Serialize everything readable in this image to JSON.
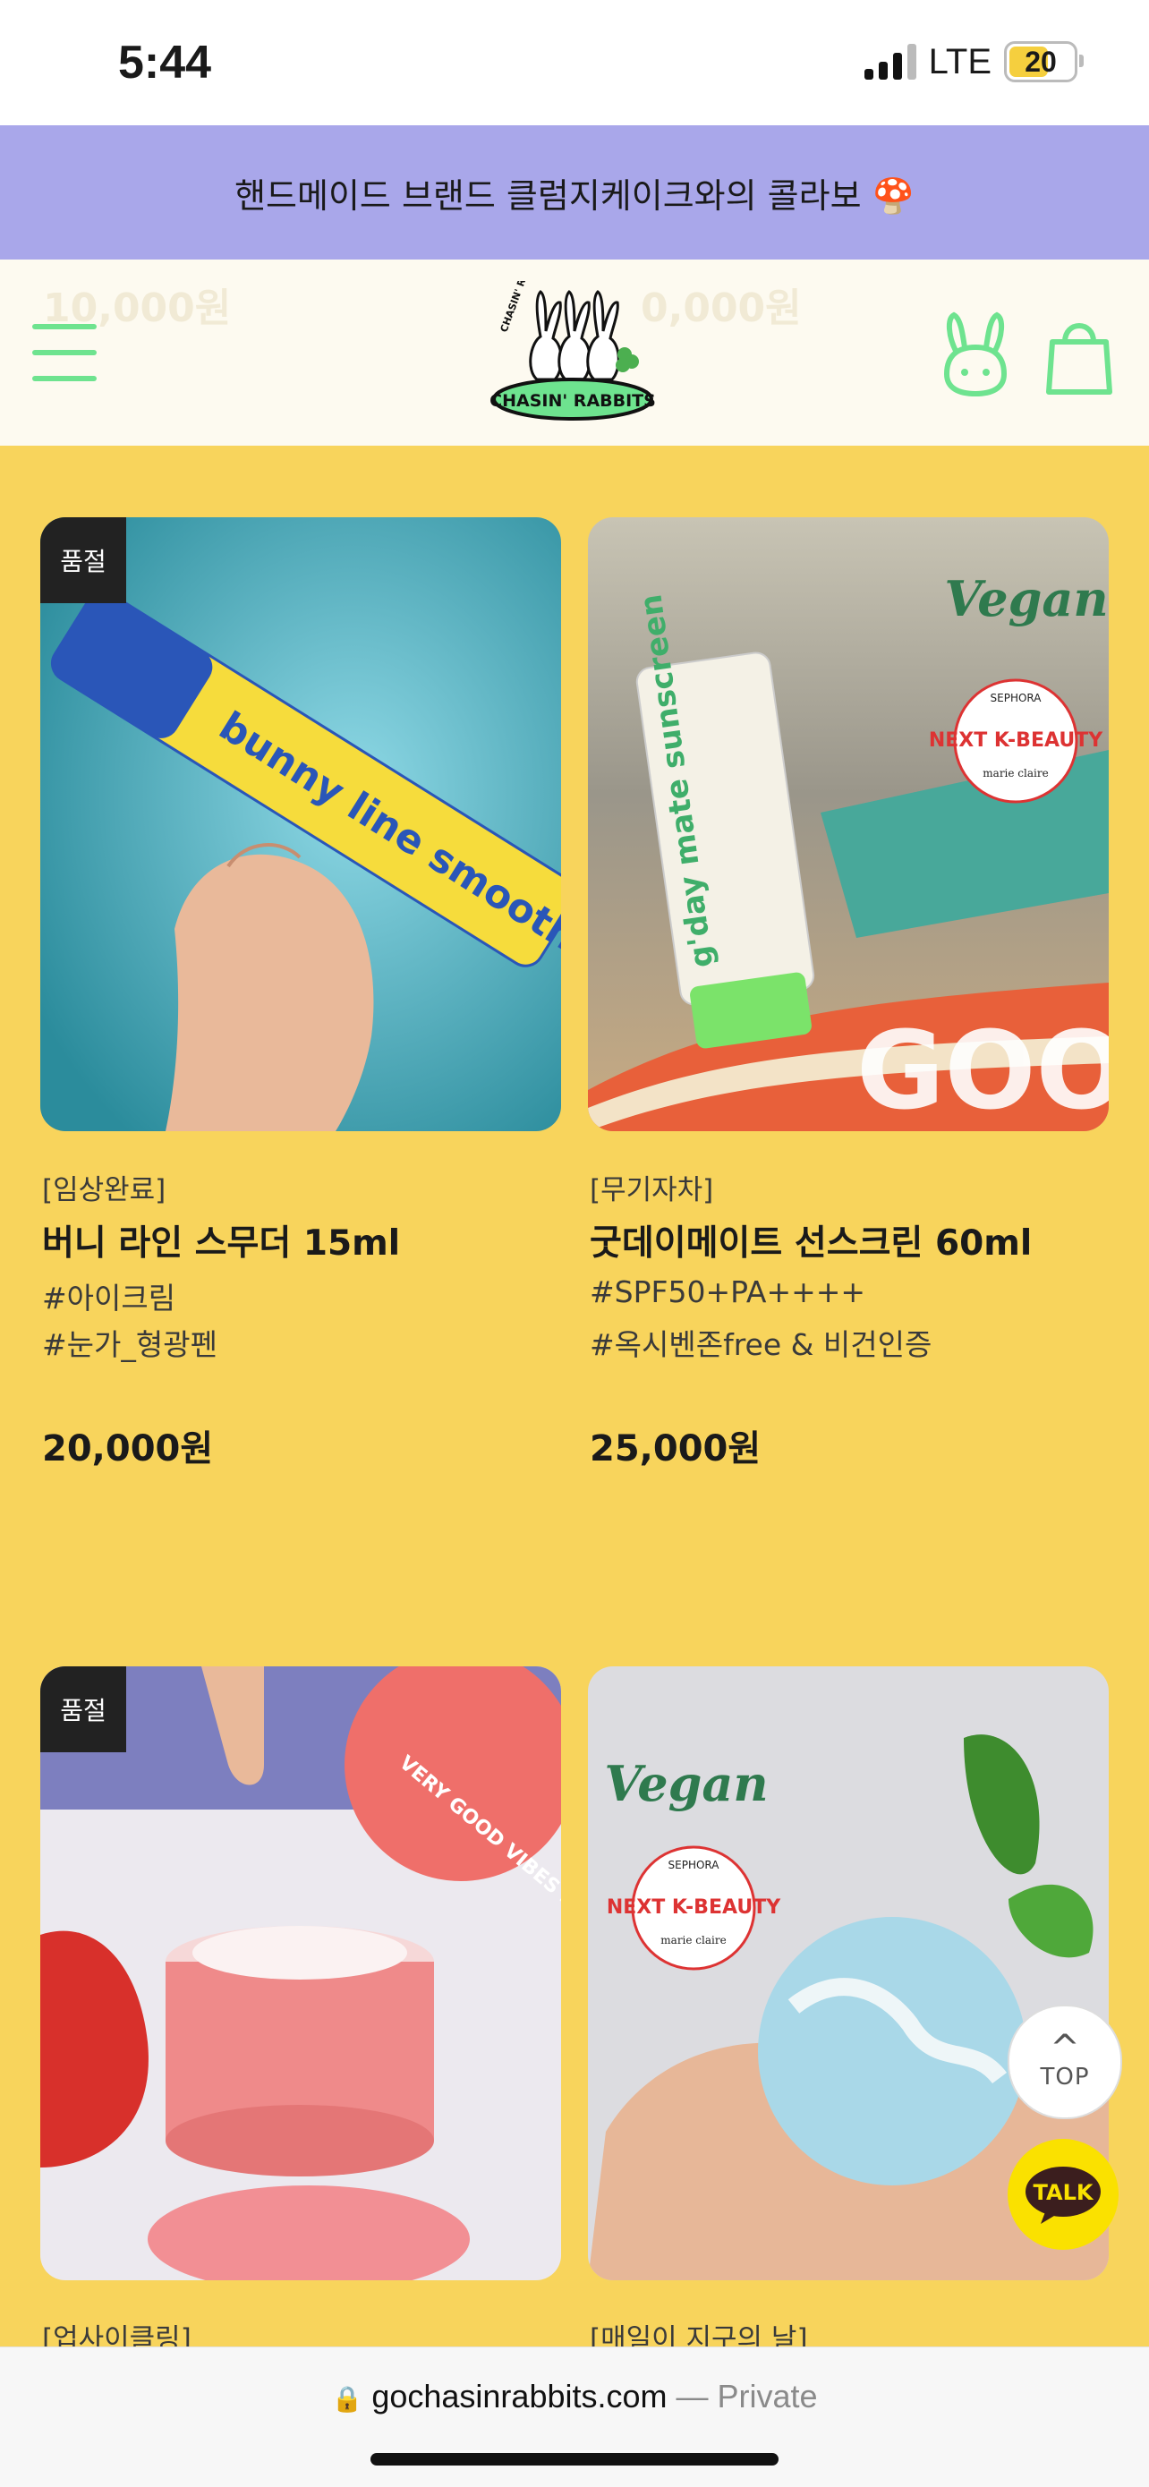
{
  "status_bar": {
    "time": "5:44",
    "network": "LTE",
    "battery": "20",
    "battery_level": 0.2
  },
  "banner": {
    "text": "핸드메이드 브랜드 클럼지케이크와의 콜라보 🍄"
  },
  "header": {
    "ghost_prices": [
      "10,000원",
      "0,000원"
    ],
    "logo_text": "CHASIN' RABBITS",
    "logo_ring_text": "CHASIN' RABBITS"
  },
  "products": [
    {
      "sold_out": "품절",
      "category": "[임상완료]",
      "name": "버니 라인 스무더 15ml",
      "tags": [
        "#아이크림",
        "#눈가_형광펜"
      ],
      "price": "20,000원",
      "image_text": "bunny line smoother"
    },
    {
      "category": "[무기자차]",
      "name": "굿데이메이트 선스크린 60ml",
      "tags": [
        "#SPF50+PA++++",
        "#옥시벤존free & 비건인증"
      ],
      "price": "25,000원",
      "image_text": "g'day mate sunscreen",
      "image_badge_top": "Vegan",
      "image_badge_award_brand": "SEPHORA",
      "image_badge_award": "NEXT K-BEAUTY",
      "image_badge_award_sub": "marie claire",
      "image_banner_text": "GOOD"
    },
    {
      "sold_out": "품절",
      "category": "[업사이클링]",
      "image_text": "VERY GOOD VIBES PERFUME CREAM"
    },
    {
      "category": "[매일이 지구의 날]",
      "image_badge_top": "Vegan",
      "image_badge_award_brand": "SEPHORA",
      "image_badge_award": "NEXT K-BEAUTY",
      "image_badge_award_sub": "marie claire"
    }
  ],
  "floating": {
    "top_label": "TOP",
    "talk_label": "TALK"
  },
  "browser": {
    "domain": "gochasinrabbits.com",
    "mode": "— Private"
  },
  "colors": {
    "page_bg": "#f8d45c",
    "banner_bg": "#a9a7ea",
    "accent_green": "#6ee38f",
    "talk_yellow": "#fae100"
  }
}
